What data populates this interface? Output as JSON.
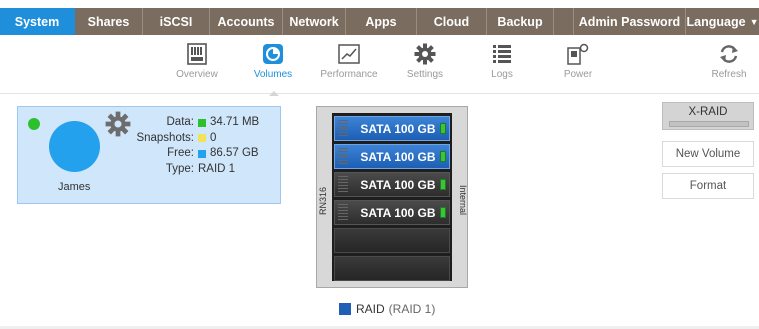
{
  "top_nav": [
    {
      "label": "System",
      "active": true
    },
    {
      "label": "Shares"
    },
    {
      "label": "iSCSI"
    },
    {
      "label": "Accounts"
    },
    {
      "label": "Network"
    },
    {
      "label": "Apps"
    },
    {
      "label": "Cloud"
    },
    {
      "label": "Backup"
    },
    {
      "label": "Admin Password"
    },
    {
      "label": "Language"
    }
  ],
  "sub_nav": [
    {
      "label": "Overview",
      "icon": "overview-icon"
    },
    {
      "label": "Volumes",
      "icon": "volumes-icon",
      "active": true
    },
    {
      "label": "Performance",
      "icon": "performance-icon"
    },
    {
      "label": "Settings",
      "icon": "gear-icon"
    },
    {
      "label": "Logs",
      "icon": "logs-icon"
    },
    {
      "label": "Power",
      "icon": "power-icon"
    },
    {
      "label": "Refresh",
      "icon": "refresh-icon"
    }
  ],
  "volume": {
    "name": "James",
    "status_color": "#2cc02c",
    "stats": [
      {
        "key": "Data:",
        "value": "34.71 MB",
        "color": "#2cc02c"
      },
      {
        "key": "Snapshots:",
        "value": "0",
        "color": "#f2e25a"
      },
      {
        "key": "Free:",
        "value": "86.57 GB",
        "color": "#23a1ec"
      },
      {
        "key": "Type:",
        "value": "RAID 1"
      }
    ]
  },
  "enclosure": {
    "model": "RN316",
    "side_label": "Internal",
    "bays": [
      {
        "label": "SATA 100 GB",
        "state": "blue"
      },
      {
        "label": "SATA 100 GB",
        "state": "blue"
      },
      {
        "label": "SATA 100 GB",
        "state": "dark"
      },
      {
        "label": "SATA 100 GB",
        "state": "dark"
      },
      {
        "label": "",
        "state": "empty"
      },
      {
        "label": "",
        "state": "empty"
      }
    ]
  },
  "legend": {
    "label": "RAID",
    "sublabel": "(RAID 1)",
    "color": "#1f5fb5"
  },
  "actions": {
    "xraid_label": "X-RAID",
    "new_volume_label": "New Volume",
    "format_label": "Format"
  },
  "colors": {
    "accent": "#1f8fdc",
    "nav_bg": "#7a6c5f"
  }
}
